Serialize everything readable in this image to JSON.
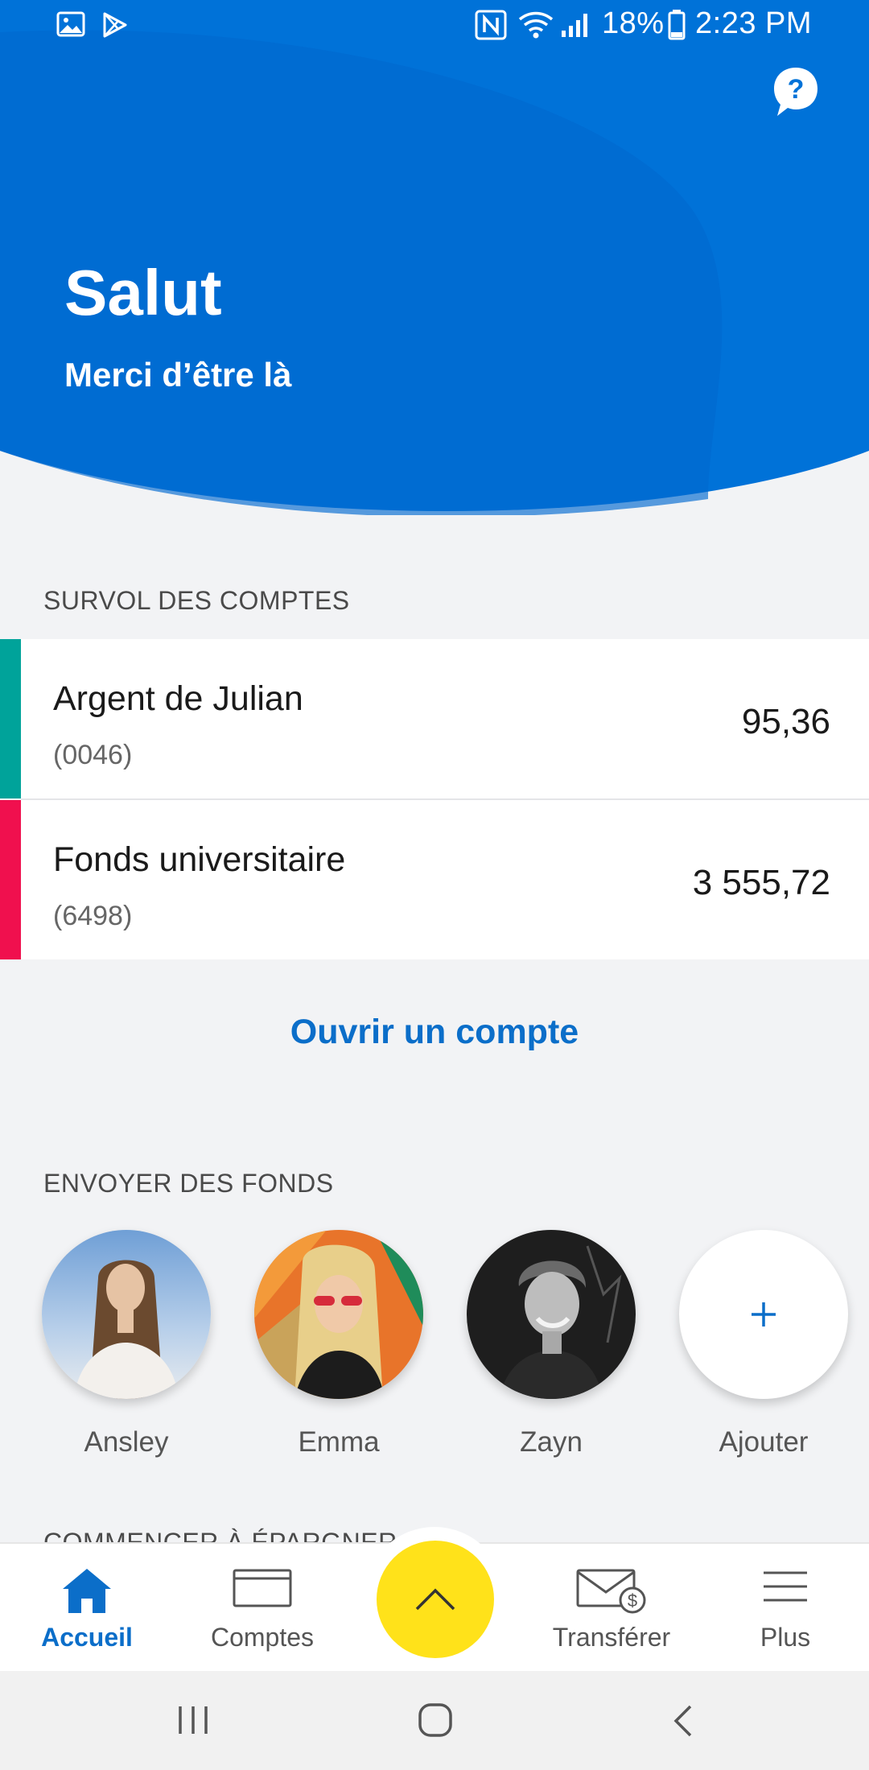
{
  "colors": {
    "brand_blue": "#0072d8",
    "brand_blue_dark": "#005fc2",
    "link_blue": "#0b6ec9",
    "fab_yellow": "#ffe21a",
    "stripe_teal": "#00a39a",
    "stripe_pink": "#f0104e"
  },
  "status_bar": {
    "battery": "18%",
    "time": "2:23 PM",
    "icons": [
      "gallery-icon",
      "play-store-icon",
      "nfc-icon",
      "wifi-icon",
      "signal-icon",
      "battery-icon"
    ]
  },
  "header": {
    "greeting": "Salut",
    "subtitle": "Merci d’être là",
    "help_icon": "help-chat-icon"
  },
  "accounts_section": {
    "label": "SURVOL DES COMPTES",
    "accounts": [
      {
        "name": "Argent de Julian",
        "number": "(0046)",
        "balance": "95,36",
        "color": "#00a39a"
      },
      {
        "name": "Fonds universitaire",
        "number": "(6498)",
        "balance": "3 555,72",
        "color": "#f0104e"
      }
    ],
    "open_account_label": "Ouvrir un compte"
  },
  "send_section": {
    "label": "ENVOYER DES FONDS",
    "contacts": [
      {
        "name": "Ansley"
      },
      {
        "name": "Emma"
      },
      {
        "name": "Zayn"
      }
    ],
    "add_label": "Ajouter"
  },
  "savings_section": {
    "label": "COMMENCER À ÉPARGNER"
  },
  "bottom_nav": {
    "items": [
      {
        "label": "Accueil",
        "icon": "home-icon",
        "active": true
      },
      {
        "label": "Comptes",
        "icon": "card-icon",
        "active": false
      },
      {
        "label": "Transférer",
        "icon": "envelope-dollar-icon",
        "active": false
      },
      {
        "label": "Plus",
        "icon": "menu-icon",
        "active": false
      }
    ],
    "fab_icon": "chevron-up-icon"
  },
  "system_nav": {
    "icons": [
      "recent-apps-icon",
      "home-circle-icon",
      "back-icon"
    ]
  }
}
